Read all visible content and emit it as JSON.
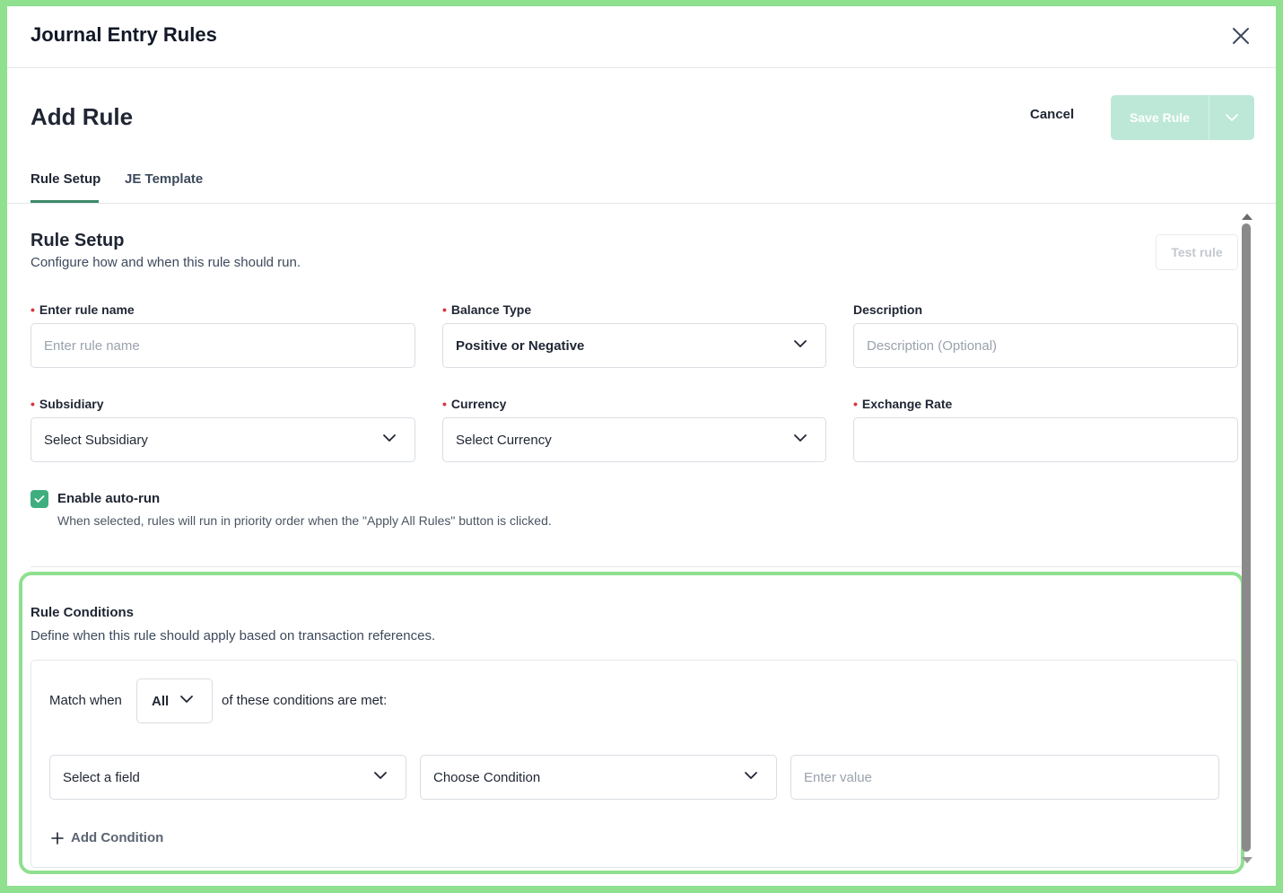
{
  "window": {
    "title": "Journal Entry Rules"
  },
  "header": {
    "page_title": "Add Rule",
    "cancel_label": "Cancel",
    "save_label": "Save Rule"
  },
  "tabs": [
    {
      "label": "Rule Setup",
      "active": true
    },
    {
      "label": "JE Template",
      "active": false
    }
  ],
  "rule_setup": {
    "title": "Rule Setup",
    "subtitle": "Configure how and when this rule should run.",
    "test_label": "Test rule",
    "fields": {
      "rule_name": {
        "label": "Enter rule name",
        "required": true,
        "placeholder": "Enter rule name"
      },
      "balance_type": {
        "label": "Balance Type",
        "required": true,
        "value": "Positive or Negative"
      },
      "description": {
        "label": "Description",
        "required": false,
        "placeholder": "Description (Optional)"
      },
      "subsidiary": {
        "label": "Subsidiary",
        "required": true,
        "value": "Select Subsidiary"
      },
      "currency": {
        "label": "Currency",
        "required": true,
        "value": "Select Currency"
      },
      "exchange_rate": {
        "label": "Exchange Rate",
        "required": true,
        "value": ""
      }
    },
    "auto_run": {
      "label": "Enable auto-run",
      "checked": true,
      "help": "When selected, rules will run in priority order when the \"Apply All Rules\" button is clicked."
    }
  },
  "conditions": {
    "title": "Rule Conditions",
    "subtitle": "Define when this rule should apply based on transaction references.",
    "match_prefix": "Match when",
    "match_value": "All",
    "match_suffix": "of these conditions are met:",
    "row": {
      "field": "Select a field",
      "condition": "Choose Condition",
      "value_placeholder": "Enter value"
    },
    "add_label": "Add Condition"
  },
  "colors": {
    "accent": "#3fae7e",
    "save_disabled": "#bde8d7",
    "highlight": "#8fe08f",
    "required": "#d9363e"
  }
}
